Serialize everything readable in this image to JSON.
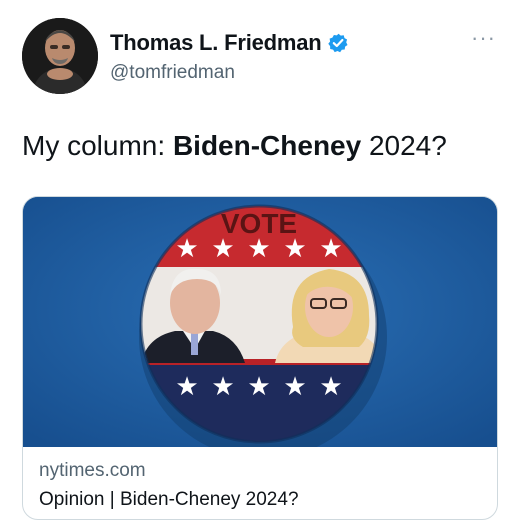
{
  "author": {
    "display_name": "Thomas L. Friedman",
    "handle": "@tomfriedman",
    "verified": true,
    "avatar_icon": "profile-photo"
  },
  "tweet": {
    "text_prefix": "My column:  ",
    "text_bold": "Biden-Cheney",
    "text_suffix": " 2024?"
  },
  "card": {
    "image_text": "VOTE",
    "domain": "nytimes.com",
    "title": "Opinion | Biden-Cheney 2024?"
  },
  "colors": {
    "verified_blue": "#1d9bf0",
    "card_background": "#1f5fa3",
    "button_red": "#c62a2f",
    "button_navy": "#1e2b5c"
  }
}
